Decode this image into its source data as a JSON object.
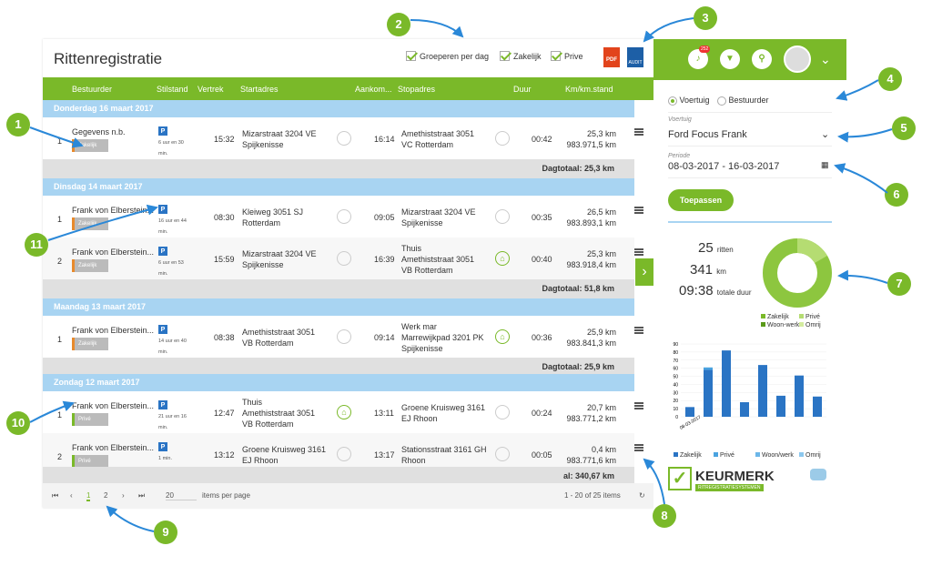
{
  "page": {
    "title": "Rittenregistratie",
    "options": [
      "Groeperen per dag",
      "Zakelijk",
      "Prive"
    ],
    "pdf_label": "PDF",
    "audit_label": "AUDIT"
  },
  "table": {
    "headers": [
      "Bestuurder",
      "Stilstand",
      "Vertrek",
      "Startadres",
      "Aankom...",
      "Stopadres",
      "Duur",
      "Km/km.stand"
    ],
    "days": [
      {
        "label": "Donderdag 16 maart 2017",
        "total": "Dagtotaal: 25,3 km"
      },
      {
        "label": "Dinsdag 14 maart 2017",
        "total": "Dagtotaal: 51,8 km"
      },
      {
        "label": "Maandag 13 maart 2017",
        "total": "Dagtotaal: 25,9 km"
      },
      {
        "label": "Zondag 12 maart 2017",
        "total": "al: 340,67 km"
      }
    ],
    "trips": [
      {
        "n": "1",
        "driver": "Gegevens n.b.",
        "tag": "Zakelijk",
        "stand": "6 uur en 30 min.",
        "dep": "15:32",
        "start1": "Mizarstraat 3204 VE",
        "start2": "Spijkenisse",
        "start3": "",
        "arr": "16:14",
        "stop1": "Amethiststraat 3051",
        "stop2": "VC Rotterdam",
        "stop3": "",
        "dur": "00:42",
        "km": "25,3 km",
        "kms": "983.971,5 km"
      },
      {
        "n": "1",
        "driver": "Frank von Elberstein...",
        "tag": "Zakelijk",
        "stand": "16 uur en 44 min.",
        "dep": "08:30",
        "start1": "Kleiweg 3051 SJ",
        "start2": "Rotterdam",
        "start3": "",
        "arr": "09:05",
        "stop1": "Mizarstraat 3204 VE",
        "stop2": "Spijkenisse",
        "stop3": "",
        "dur": "00:35",
        "km": "26,5 km",
        "kms": "983.893,1 km"
      },
      {
        "n": "2",
        "driver": "Frank von Elberstein...",
        "tag": "Zakelijk",
        "stand": "6 uur en 53 min.",
        "dep": "15:59",
        "start1": "Mizarstraat 3204 VE",
        "start2": "Spijkenisse",
        "start3": "",
        "arr": "16:39",
        "stop1": "Thuis",
        "stop2": "Amethiststraat 3051",
        "stop3": "VB Rotterdam",
        "dur": "00:40",
        "km": "25,3 km",
        "kms": "983.918,4 km"
      },
      {
        "n": "1",
        "driver": "Frank von Elberstein...",
        "tag": "Zakelijk",
        "stand": "14 uur en 40 min.",
        "dep": "08:38",
        "start1": "Amethiststraat 3051",
        "start2": "VB Rotterdam",
        "start3": "",
        "arr": "09:14",
        "stop1": "Werk mar",
        "stop2": "Marrewijkpad 3201 PK",
        "stop3": "Spijkenisse",
        "dur": "00:36",
        "km": "25,9 km",
        "kms": "983.841,3 km"
      },
      {
        "n": "1",
        "driver": "Frank von Elberstein...",
        "tag": "Privé",
        "stand": "21 uur en 16 min.",
        "dep": "12:47",
        "start1": "Thuis",
        "start2": "Amethiststraat 3051",
        "start3": "VB Rotterdam",
        "arr": "13:11",
        "stop1": "Groene Kruisweg 3161",
        "stop2": "EJ Rhoon",
        "stop3": "",
        "dur": "00:24",
        "km": "20,7 km",
        "kms": "983.771,2 km"
      },
      {
        "n": "2",
        "driver": "Frank von Elberstein...",
        "tag": "Privé",
        "stand": "1 min.",
        "dep": "13:12",
        "start1": "Groene Kruisweg 3161",
        "start2": "EJ Rhoon",
        "start3": "",
        "arr": "13:17",
        "stop1": "Stationsstraat 3161 GH",
        "stop2": "Rhoon",
        "stop3": "",
        "dur": "00:05",
        "km": "0,4 km",
        "kms": "983.771,6 km"
      }
    ]
  },
  "pager": {
    "p1": "1",
    "p2": "2",
    "per_page": "20",
    "per_label": "items per page",
    "range": "1 - 20 of 25 items"
  },
  "sidebar": {
    "notif_count": "252",
    "radio1": "Voertuig",
    "radio2": "Bestuurder",
    "vehicle_label": "Voertuig",
    "vehicle": "Ford Focus Frank",
    "period_label": "Periode",
    "period": "08-03-2017 - 16-03-2017",
    "apply": "Toepassen",
    "rides_n": "25",
    "rides_l": "ritten",
    "km_n": "341",
    "km_l": "km",
    "dur_n": "09:38",
    "dur_l": "totale duur",
    "donut_legend": [
      "Zakelijk",
      "Privé",
      "Woon-werk",
      "Omrij"
    ],
    "bar_legend": [
      "Zakelijk",
      "Privé",
      "Woon/werk",
      "Omrij"
    ],
    "logo_title": "KEURMERK",
    "logo_sub": "RITREGISTRATIESYSTEMEN"
  },
  "chart_data": {
    "type": "bar",
    "x_first_label": "08-03-2017",
    "ylim": [
      0,
      90
    ],
    "yticks": [
      0,
      10,
      20,
      30,
      40,
      50,
      60,
      70,
      80,
      90
    ],
    "series": [
      {
        "name": "Zakelijk",
        "values": [
          12,
          58,
          82,
          18,
          64,
          26,
          51,
          25
        ]
      },
      {
        "name": "Privé",
        "values": [
          0,
          3,
          0,
          0,
          0,
          0,
          0,
          0
        ]
      }
    ]
  },
  "callouts": [
    "1",
    "2",
    "3",
    "4",
    "5",
    "6",
    "7",
    "8",
    "9",
    "10",
    "11"
  ]
}
